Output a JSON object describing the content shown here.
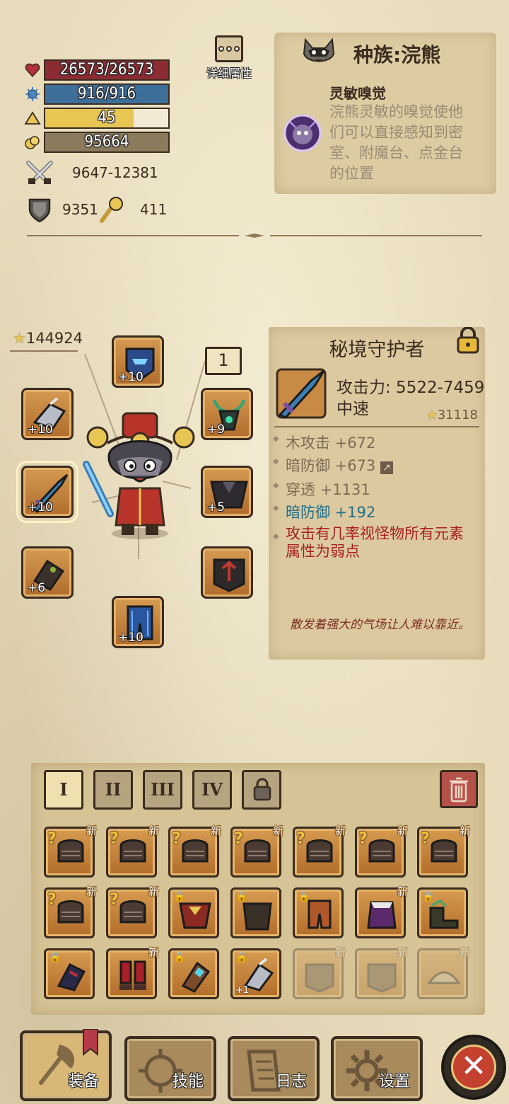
{
  "stats": {
    "hp": "26573/26573",
    "mp": "916/916",
    "level": "45",
    "gold": "95664",
    "attack": "9647-12381",
    "defense": "9351",
    "luck": "411",
    "hp_fill": 1.0,
    "mp_fill": 1.0,
    "level_fill": 0.72,
    "colors": {
      "hp": "#8c2b33",
      "mp": "#3d6f9a",
      "level": "#e7c654",
      "gold": "#8b7a5c"
    }
  },
  "detail_button": {
    "label": "详细属性"
  },
  "race": {
    "title": "种族:浣熊",
    "skill_name": "灵敏嗅觉",
    "skill_desc": "浣熊灵敏的嗅觉使他们可以直接感知到密室、附魔台、点金台的位置"
  },
  "equipment": {
    "power": "144924",
    "tag": "1",
    "slots": [
      {
        "plus": "+10",
        "icon": "helmet-icon"
      },
      {
        "plus": "+10",
        "icon": "gauntlet-icon"
      },
      {
        "plus": "+9",
        "icon": "amulet-icon"
      },
      {
        "plus": "+10",
        "icon": "sword-icon"
      },
      {
        "plus": "+5",
        "icon": "cloak-icon"
      },
      {
        "plus": "+6",
        "icon": "bracer-icon"
      },
      {
        "plus": "",
        "icon": "armor-icon"
      },
      {
        "plus": "+10",
        "icon": "leggings-icon"
      }
    ]
  },
  "item": {
    "name": "秘境守护者",
    "attack": "攻击力: 5522-7459",
    "speed": "中速",
    "score": "31118",
    "attrs": [
      "木攻击 +672",
      "暗防御 +673",
      "穿透 +1131",
      "暗防御 +192",
      "攻击有几率视怪物所有元素属性为弱点"
    ],
    "flavor": "散发着强大的气场让人难以靠近。"
  },
  "inventory": {
    "tabs": [
      "I",
      "II",
      "III",
      "IV"
    ],
    "new_label": "新",
    "row1_new": [
      "新",
      "新",
      "新",
      "新",
      "新",
      "新",
      "新"
    ],
    "row2_new": [
      "新",
      "新",
      "",
      "",
      "",
      "新",
      ""
    ],
    "row3_new": [
      "",
      "新",
      "",
      "",
      "新",
      "新",
      "新"
    ],
    "plus_label": "+1"
  },
  "nav": {
    "equip": "装备",
    "skills": "技能",
    "log": "日志",
    "settings": "设置"
  }
}
